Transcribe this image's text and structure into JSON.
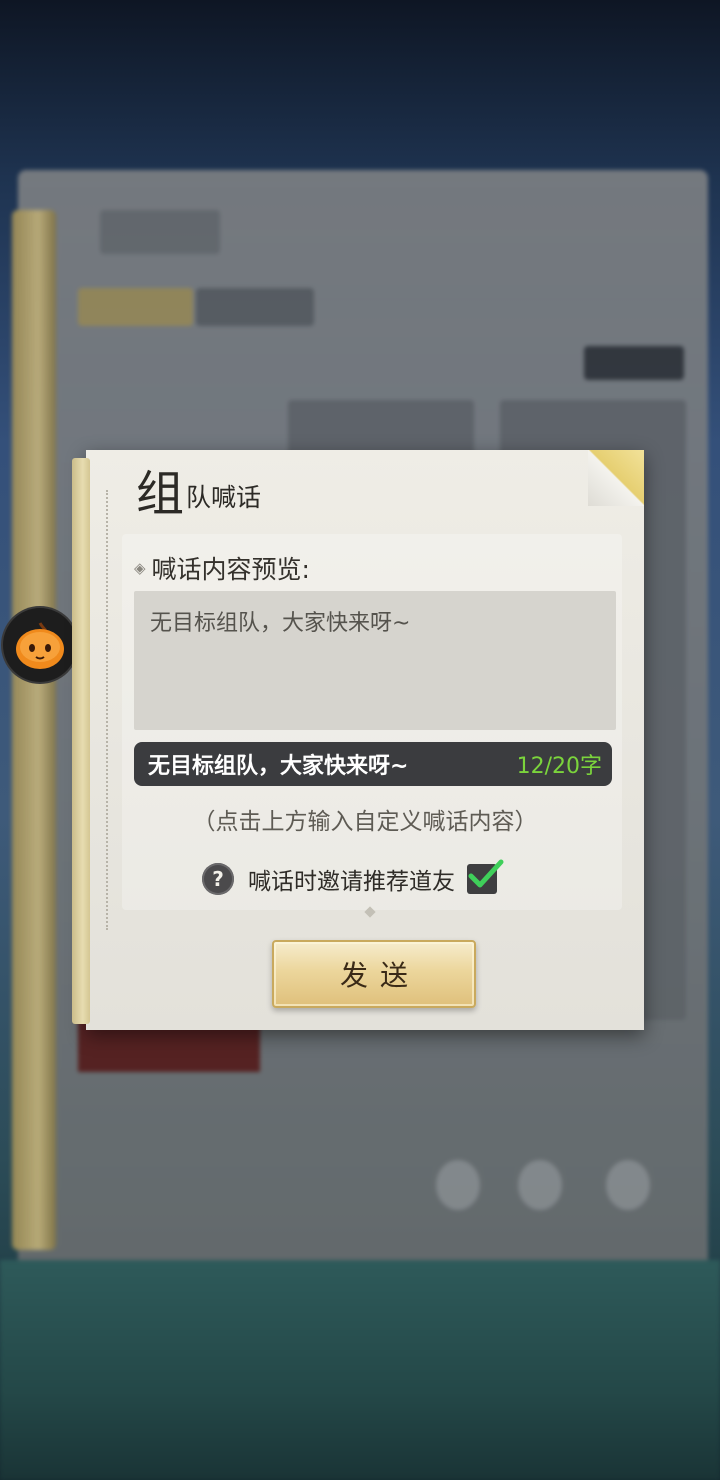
{
  "dialog": {
    "title_big": "组",
    "title_small": "队喊话",
    "preview_label": "喊话内容预览:",
    "preview_text": "无目标组队，大家快来呀~",
    "input_text": "无目标组队，大家快来呀~",
    "char_count": "12/20字",
    "hint": "（点击上方输入自定义喊话内容）",
    "invite_label": "喊话时邀请推荐道友",
    "invite_checked": true,
    "send_label": "发送"
  },
  "icons": {
    "help": "?",
    "floating_button": "pumpkin-icon",
    "checkbox": "checkmark-icon"
  },
  "colors": {
    "count_color": "#7bd43c",
    "check_color": "#3fcf5a",
    "accent_gold": "#e6cf71"
  }
}
